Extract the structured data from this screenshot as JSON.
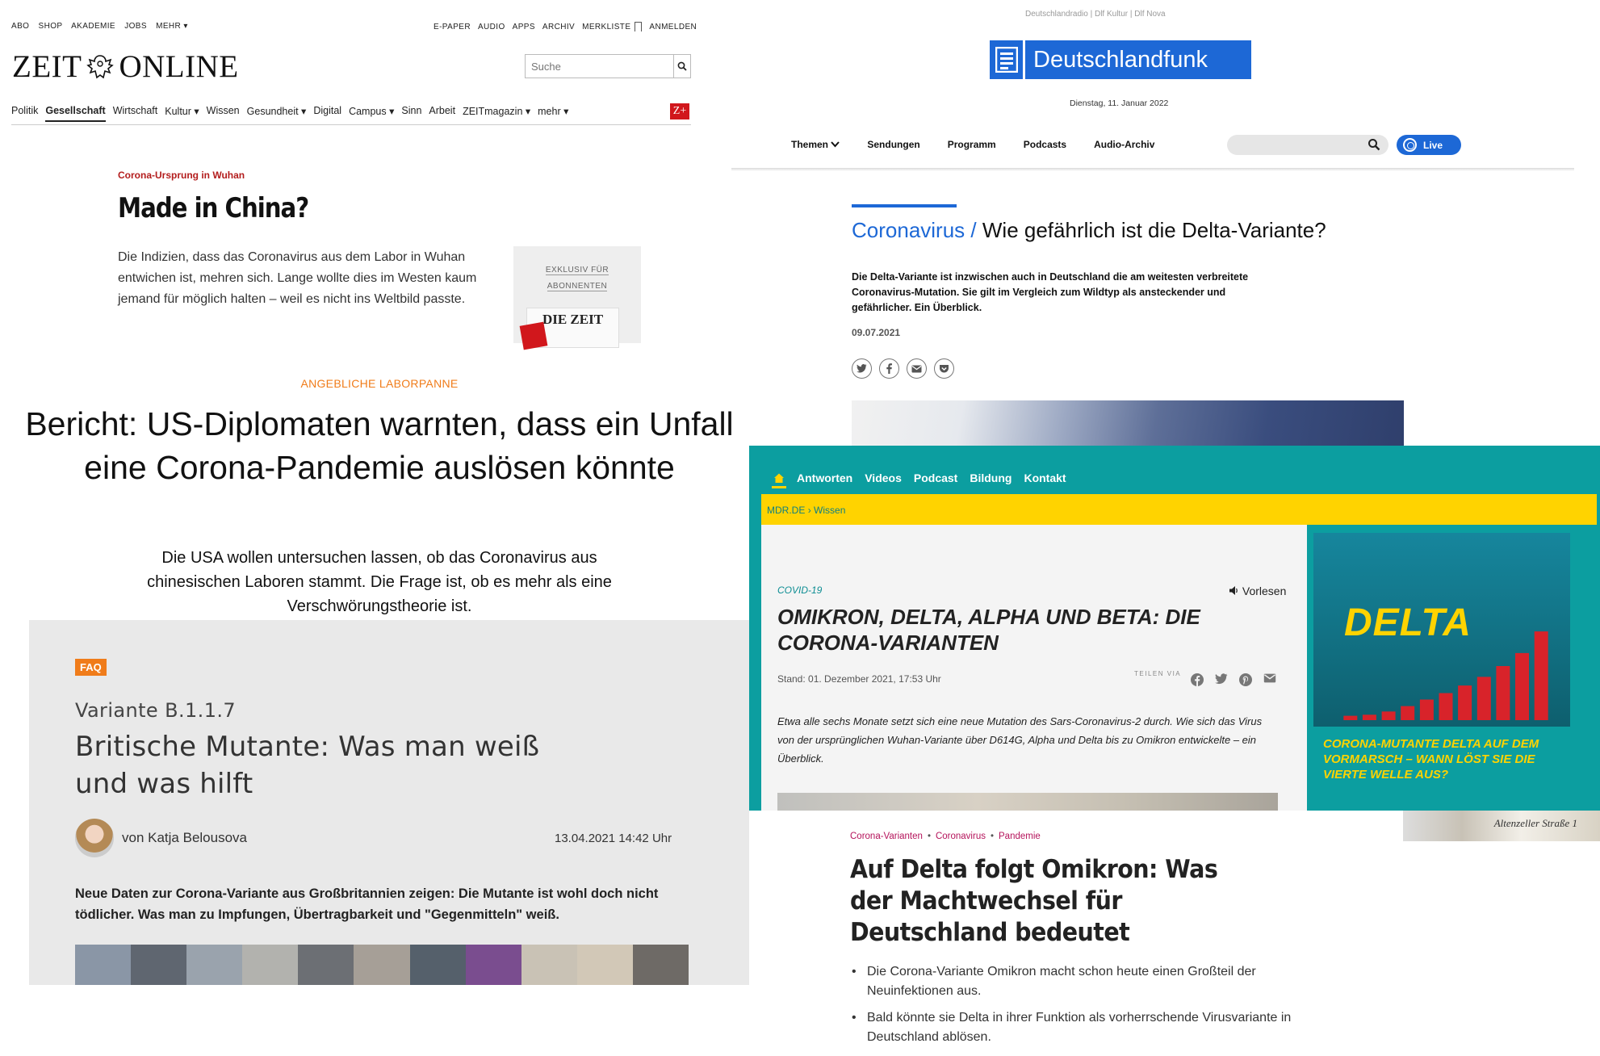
{
  "zeit": {
    "top_nav": [
      "ABO",
      "SHOP",
      "AKADEMIE",
      "JOBS",
      "MEHR ▾"
    ],
    "top_nav_right": [
      "E-PAPER",
      "AUDIO",
      "APPS",
      "ARCHIV",
      "MERKLISTE",
      "ANMELDEN"
    ],
    "logo_left": "ZEIT",
    "logo_right": "ONLINE",
    "search_placeholder": "Suche",
    "main_nav": [
      "Politik",
      "Gesellschaft",
      "Wirtschaft",
      "Kultur ▾",
      "Wissen",
      "Gesundheit ▾",
      "Digital",
      "Campus ▾",
      "Sinn",
      "Arbeit",
      "ZEITmagazin ▾",
      "mehr ▾"
    ],
    "active_nav": "Gesellschaft",
    "zplus": "Z+",
    "kicker": "Corona-Ursprung in Wuhan",
    "title": "Made in China?",
    "teaser": "Die Indizien, dass das Coronavirus aus dem Labor in Wuhan entwichen ist, mehren sich. Lange wollte dies im Westen kaum jemand für möglich halten – weil es nicht ins Weltbild passte.",
    "promo_line1": "EXKLUSIV FÜR",
    "promo_line2": "ABONNENTEN",
    "promo_paper": "DIE ZEIT"
  },
  "dlf": {
    "subbrands": "Deutschlandradio | Dlf Kultur | Dlf Nova",
    "brand": "Deutschlandfunk",
    "date": "Dienstag, 11. Januar 2022",
    "nav": [
      "Themen",
      "Sendungen",
      "Programm",
      "Podcasts",
      "Audio-Archiv"
    ],
    "live": "Live",
    "category": "Coronavirus",
    "separator": "/",
    "headline": "Wie gefährlich ist die Delta-Variante?",
    "lead": "Die Delta-Variante ist inzwischen auch in Deutschland die am weitesten verbreitete Coronavirus-Mutation. Sie gilt im Vergleich zum Wildtyp als ansteckender und gefährlicher. Ein Überblick.",
    "pub_date": "09.07.2021",
    "share_icons": [
      "twitter-icon",
      "facebook-icon",
      "mail-icon",
      "pocket-icon"
    ]
  },
  "correctiv": {
    "kicker": "ANGEBLICHE LABORPANNE",
    "title": "Bericht: US-Diplomaten warnten, dass ein Unfall eine Corona-Pandemie auslösen könnte",
    "subtitle": "Die USA wollen untersuchen lassen, ob das Coronavirus aus chinesischen Laboren stammt. Die Frage ist, ob es mehr als eine Verschwörungstheorie ist."
  },
  "faq": {
    "badge": "FAQ",
    "overline": "Variante B.1.1.7",
    "title": "Britische Mutante: Was man weiß und was hilft",
    "author": "von Katja Belousova",
    "date": "13.04.2021 14:42 Uhr",
    "lead": "Neue Daten zur Corona-Variante aus Großbritannien zeigen: Die Mutante ist wohl doch nicht tödlicher. Was man zu Impfungen, Übertragbarkeit und \"Gegenmitteln\" weiß.",
    "strip_colors": [
      "#8a96a6",
      "#5f6670",
      "#9aa3ad",
      "#b2b2ae",
      "#6c6f74",
      "#a69f97",
      "#55606b",
      "#7a4d8f",
      "#c9c2b5",
      "#d2c8b7",
      "#6e6a66"
    ]
  },
  "mdr": {
    "nav": [
      "Antworten",
      "Videos",
      "Podcast",
      "Bildung",
      "Kontakt"
    ],
    "breadcrumb_home": "MDR.DE",
    "breadcrumb_sep": "›",
    "breadcrumb_section": "Wissen",
    "tag": "COVID-19",
    "listen": "Vorlesen",
    "title": "OMIKRON, DELTA, ALPHA UND BETA: DIE CORONA-VARIANTEN",
    "stand": "Stand:  01. Dezember 2021,   17:53 Uhr",
    "share_label": "TEILEN VIA",
    "lead": "Etwa alle sechs Monate setzt sich eine neue Mutation des Sars-Coronavirus-2 durch. Wie sich das Virus von der ursprünglichen Wuhan-Variante über D614G, Alpha und Delta bis zu Omikron entwickelte – ein Überblick.",
    "card_image_title": "DELTA",
    "card_bars": [
      0.04,
      0.05,
      0.08,
      0.13,
      0.19,
      0.25,
      0.32,
      0.4,
      0.5,
      0.62,
      0.82
    ],
    "card_caption": "CORONA-MUTANTE DELTA AUF DEM VORMARSCH – WANN LÖST SIE DIE VIERTE WELLE AUS?",
    "accent_teal": "#0c9ea0",
    "accent_yellow": "#ffd300"
  },
  "bottom": {
    "tags": [
      "Corona-Varianten",
      "Coronavirus",
      "Pandemie"
    ],
    "tag_sep": "•",
    "street_sign": "Altenzeller Straße 1",
    "title": "Auf Delta folgt Omikron: Was der Machtwechsel für Deutschland bedeutet",
    "bullets": [
      "Die Corona-Variante Omikron macht schon heute einen Großteil der Neuinfektionen aus.",
      "Bald könnte sie Delta in ihrer Funktion als vorherrschende Virusvariante in Deutschland ablösen."
    ]
  }
}
